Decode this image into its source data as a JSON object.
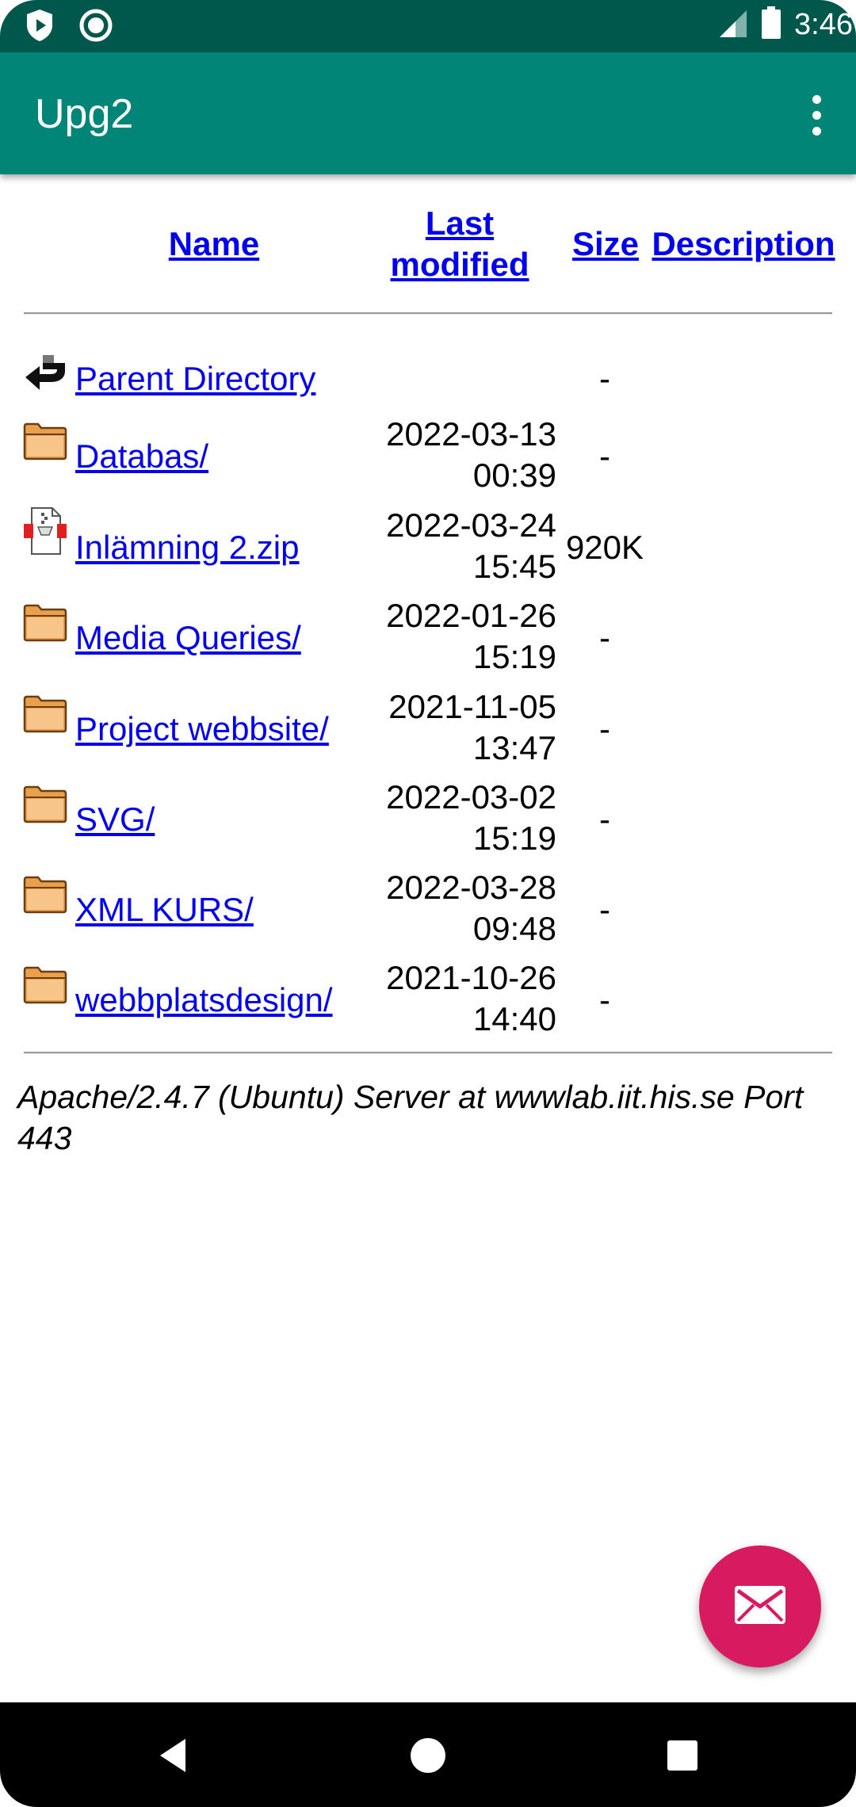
{
  "status_bar": {
    "time": "3:46",
    "left_icons": [
      "shield-play-icon",
      "circle-record-icon"
    ],
    "right_icons": [
      "cell-signal-icon",
      "battery-icon"
    ]
  },
  "app_bar": {
    "title": "Upg2",
    "menu_icon": "more-vert-icon"
  },
  "listing": {
    "headers": {
      "name": "Name",
      "last_modified_line1": "Last",
      "last_modified_line2": "modified",
      "size": "Size",
      "description": "Description"
    },
    "rows": [
      {
        "icon": "back-arrow-icon",
        "name": "Parent Directory",
        "date": "",
        "time": "",
        "size": "-"
      },
      {
        "icon": "folder-icon",
        "name": "Databas/",
        "date": "2022-03-13",
        "time": "00:39",
        "size": "-"
      },
      {
        "icon": "compressed-file-icon",
        "name": "Inlämning 2.zip",
        "date": "2022-03-24",
        "time": "15:45",
        "size": "920K"
      },
      {
        "icon": "folder-icon",
        "name": "Media Queries/",
        "date": "2022-01-26",
        "time": "15:19",
        "size": "-"
      },
      {
        "icon": "folder-icon",
        "name": "Project webbsite/",
        "date": "2021-11-05",
        "time": "13:47",
        "size": "-"
      },
      {
        "icon": "folder-icon",
        "name": "SVG/",
        "date": "2022-03-02",
        "time": "15:19",
        "size": "-"
      },
      {
        "icon": "folder-icon",
        "name": "XML KURS/",
        "date": "2022-03-28",
        "time": "09:48",
        "size": "-"
      },
      {
        "icon": "folder-icon",
        "name": "webbplatsdesign/",
        "date": "2021-10-26",
        "time": "14:40",
        "size": "-"
      }
    ],
    "server_signature": "Apache/2.4.7 (Ubuntu) Server at wwwlab.iit.his.se Port 443"
  },
  "fab": {
    "icon": "mail-icon",
    "color": "#d81b60"
  },
  "nav_bar": {
    "icons": [
      "back-icon",
      "home-icon",
      "recents-icon"
    ]
  },
  "colors": {
    "status_bar": "#00574b",
    "app_bar": "#008577",
    "link": "#0000ee",
    "accent": "#d81b60"
  }
}
